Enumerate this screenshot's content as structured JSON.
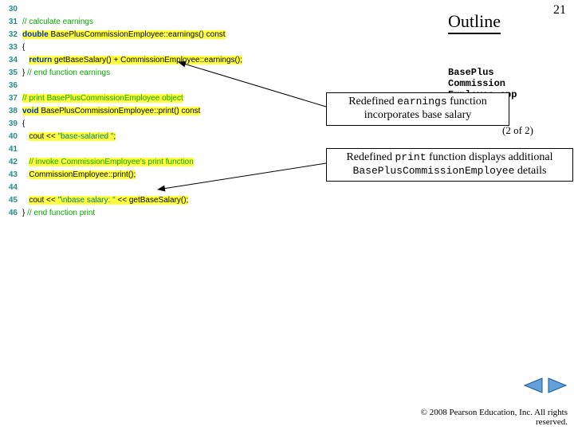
{
  "header": {
    "outline": "Outline",
    "page": "21"
  },
  "file": {
    "name_line1": "BasePlus",
    "name_line2": "Commission",
    "name_line3": "Employee.cpp",
    "part": "(2 of 2)"
  },
  "callout1": {
    "pre": "Redefined ",
    "mono": "earnings",
    "mid": " function",
    "line2": "incorporates base salary"
  },
  "callout2": {
    "pre": "Redefined ",
    "mono1": "print",
    "mid": " function displays additional",
    "mono2": "BasePlusCommissionEmployee",
    "tail": " details"
  },
  "code": [
    {
      "n": "30",
      "plain": ""
    },
    {
      "n": "31",
      "comment": "// calculate earnings"
    },
    {
      "n": "32",
      "hl_kw": "double",
      "hl_rest": " BasePlusCommissionEmployee::earnings() const"
    },
    {
      "n": "33",
      "plain": "{"
    },
    {
      "n": "34",
      "indent": "   ",
      "hl_kw": "return",
      "hl_rest": " getBaseSalary() + CommissionEmployee::earnings();"
    },
    {
      "n": "35",
      "plain_pre": "} ",
      "comment": "// end function earnings"
    },
    {
      "n": "36",
      "plain": ""
    },
    {
      "n": "37",
      "hl_comment": "// print BasePlusCommissionEmployee object"
    },
    {
      "n": "38",
      "hl_kw": "void",
      "hl_rest": " BasePlusCommissionEmployee::print() const"
    },
    {
      "n": "39",
      "plain": "{"
    },
    {
      "n": "40",
      "indent": "   ",
      "hl_pre": "cout << ",
      "hl_str": "\"base-salaried \"",
      "hl_post": ";"
    },
    {
      "n": "41",
      "plain": ""
    },
    {
      "n": "42",
      "indent": "   ",
      "hl_comment": "// invoke CommissionEmployee's print function"
    },
    {
      "n": "43",
      "indent": "   ",
      "hl_rest": "CommissionEmployee::print();"
    },
    {
      "n": "44",
      "plain": ""
    },
    {
      "n": "45",
      "indent": "   ",
      "hl_pre": "cout << ",
      "hl_str": "\"\\nbase salary: \"",
      "hl_post": " << getBaseSalary();"
    },
    {
      "n": "46",
      "plain_pre": "} ",
      "comment": "// end function print"
    }
  ],
  "copyright": "© 2008 Pearson Education, Inc.  All rights reserved."
}
